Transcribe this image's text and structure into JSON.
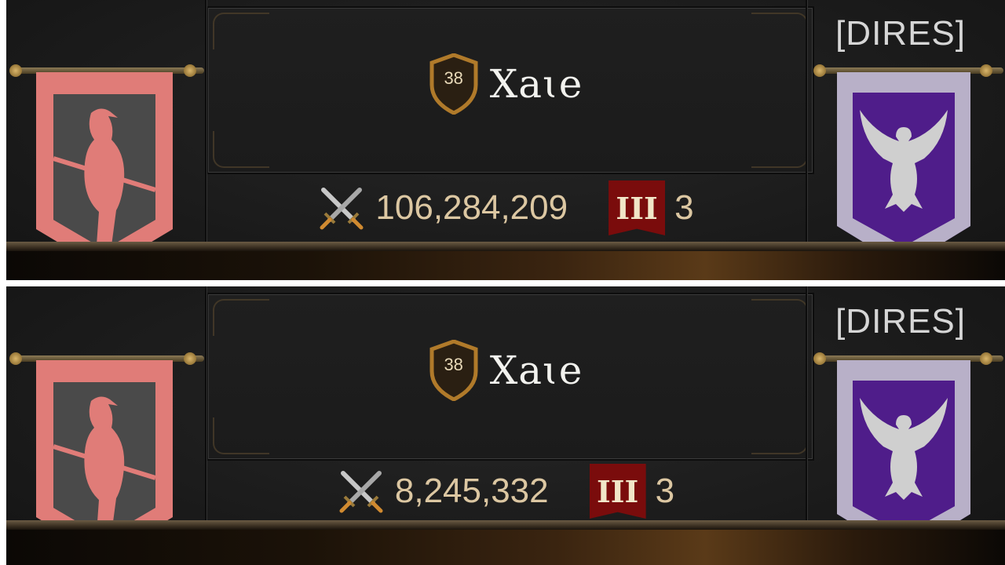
{
  "panels": [
    {
      "level": "38",
      "player_name": "Xaɩe",
      "power": "106,284,209",
      "tier_numeral": "III",
      "tier_count": "3",
      "guild_tag": "[DIRES]"
    },
    {
      "level": "38",
      "player_name": "Xaɩe",
      "power": "8,245,332",
      "tier_numeral": "III",
      "tier_count": "3",
      "guild_tag": "[DIRES]"
    }
  ],
  "colors": {
    "left_banner_emblem": "#e07c78",
    "left_banner_field": "#4a4a4a",
    "right_banner_field": "#4f1d8a",
    "right_banner_emblem": "#cfcfcf",
    "tier_badge": "#7a0c0c",
    "level_badge": "#b07a2a"
  },
  "icons": {
    "level": "shield-badge-icon",
    "power": "crossed-swords-icon",
    "left_emblem": "bird-on-branch-emblem",
    "right_emblem": "eagle-emblem"
  }
}
